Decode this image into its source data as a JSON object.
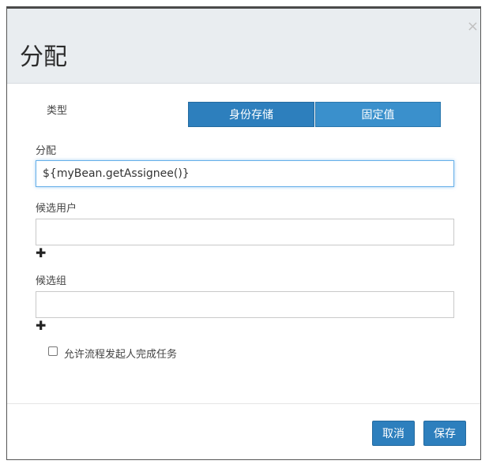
{
  "dialog": {
    "title": "分配",
    "close_glyph": "×"
  },
  "type_field": {
    "label": "类型",
    "options": [
      "身份存储",
      "固定值"
    ],
    "selected": "身份存储"
  },
  "assignment": {
    "label": "分配",
    "value": "${myBean.getAssignee()}"
  },
  "candidate_users": {
    "label": "候选用户",
    "value": "",
    "add_icon": "plus-icon"
  },
  "candidate_groups": {
    "label": "候选组",
    "value": "",
    "add_icon": "plus-icon"
  },
  "allow_initiator": {
    "label": "允许流程发起人完成任务",
    "checked": false
  },
  "footer": {
    "cancel_label": "取消",
    "save_label": "保存"
  },
  "colors": {
    "primary": "#2d7fbd",
    "secondary": "#3a90cc",
    "header_bg": "#e9edf0"
  }
}
